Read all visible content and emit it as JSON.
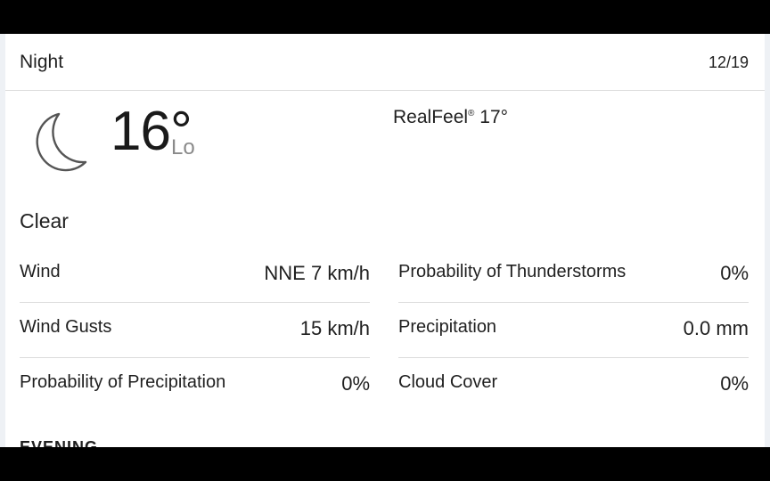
{
  "header": {
    "title": "Night",
    "date": "12/19"
  },
  "current": {
    "icon": "moon-icon",
    "temperature": "16°",
    "temp_type": "Lo",
    "realfeel_label": "RealFeel",
    "realfeel_mark": "®",
    "realfeel_value": "17°",
    "phrase": "Clear"
  },
  "details": {
    "left": [
      {
        "label": "Wind",
        "value": "NNE 7 km/h"
      },
      {
        "label": "Wind Gusts",
        "value": "15 km/h"
      },
      {
        "label": "Probability of Precipitation",
        "value": "0%"
      }
    ],
    "right": [
      {
        "label": "Probability of Thunderstorms",
        "value": "0%"
      },
      {
        "label": "Precipitation",
        "value": "0.0 mm"
      },
      {
        "label": "Cloud Cover",
        "value": "0%"
      }
    ]
  },
  "next_section": {
    "title": "EVENING"
  }
}
